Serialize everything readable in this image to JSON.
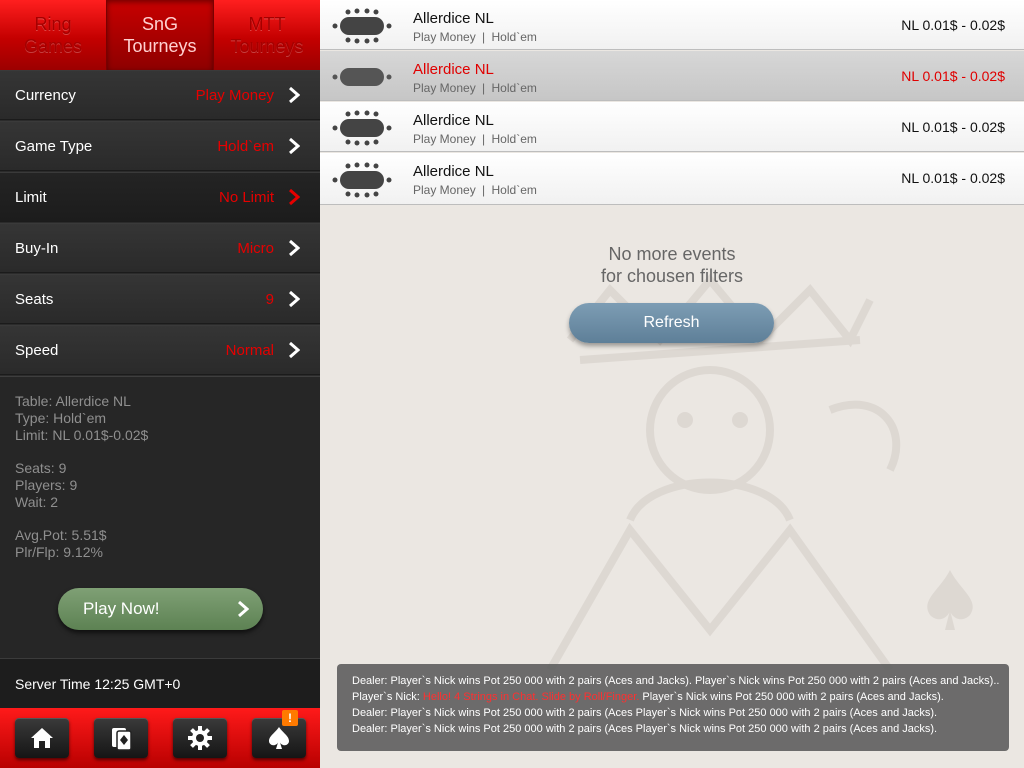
{
  "tabs": [
    {
      "label_1": "Ring",
      "label_2": "Games"
    },
    {
      "label_1": "SnG",
      "label_2": "Tourneys"
    },
    {
      "label_1": "MTT",
      "label_2": "Tourneys"
    }
  ],
  "filters": [
    {
      "label": "Currency",
      "value": "Play Money"
    },
    {
      "label": "Game Type",
      "value": "Hold`em"
    },
    {
      "label": "Limit",
      "value": "No Limit"
    },
    {
      "label": "Buy-In",
      "value": "Micro"
    },
    {
      "label": "Seats",
      "value": "9"
    },
    {
      "label": "Speed",
      "value": "Normal"
    }
  ],
  "info": {
    "table": "Table: Allerdice NL",
    "type": "Type: Hold`em",
    "limit": "Limit: NL 0.01$-0.02$",
    "seats": "Seats: 9",
    "players": "Players: 9",
    "wait": "Wait: 2",
    "avg_pot": "Avg.Pot: 5.51$",
    "plr_flp": "Plr/Flp: 9.12%"
  },
  "play_button": "Play Now!",
  "server_time": "Server Time 12:25 GMT+0",
  "bottom_bar": {
    "badge": "!"
  },
  "games": [
    {
      "name": "Allerdice NL",
      "currency": "Play Money",
      "separator": "|",
      "game": "Hold`em",
      "stakes": "NL 0.01$ - 0.02$"
    },
    {
      "name": "Allerdice NL",
      "currency": "Play Money",
      "separator": "|",
      "game": "Hold`em",
      "stakes": "NL 0.01$ - 0.02$"
    },
    {
      "name": "Allerdice NL",
      "currency": "Play Money",
      "separator": "|",
      "game": "Hold`em",
      "stakes": "NL 0.01$ - 0.02$"
    },
    {
      "name": "Allerdice NL",
      "currency": "Play Money",
      "separator": "|",
      "game": "Hold`em",
      "stakes": "NL 0.01$ - 0.02$"
    }
  ],
  "empty_message": {
    "line_1": "No more events",
    "line_2": "for chousen filters"
  },
  "refresh_button": "Refresh",
  "chat": [
    {
      "speaker": "Dealer:",
      "highlight": "",
      "text": "Player`s Nick wins Pot 250 000 with 2 pairs (Aces and Jacks). Player`s Nick wins Pot 250 000 with 2 pairs (Aces and Jacks).."
    },
    {
      "speaker": "Player`s Nick:",
      "highlight": "Hello! 4 Strings in Chat. Slide by Roll/Finger.",
      "text": "Player`s Nick wins Pot 250 000 with 2 pairs (Aces and Jacks)."
    },
    {
      "speaker": "Dealer:",
      "highlight": "",
      "text": "Player`s Nick wins Pot 250 000 with 2 pairs (Aces Player`s Nick wins Pot 250 000 with 2 pairs (Aces and Jacks)."
    },
    {
      "speaker": "Dealer:",
      "highlight": "",
      "text": "Player`s Nick wins Pot 250 000 with 2 pairs (Aces Player`s Nick wins Pot 250 000 with 2 pairs (Aces and Jacks)."
    }
  ],
  "colors": {
    "accent_red": "#e60000",
    "play_green": "#6e9164",
    "refresh_blue": "#6e8ea6",
    "panel_dark": "#2b2b2b"
  },
  "icons": [
    "chevron-right-icon",
    "home-icon",
    "cards-icon",
    "gear-icon",
    "spade-icon",
    "table-icon"
  ]
}
